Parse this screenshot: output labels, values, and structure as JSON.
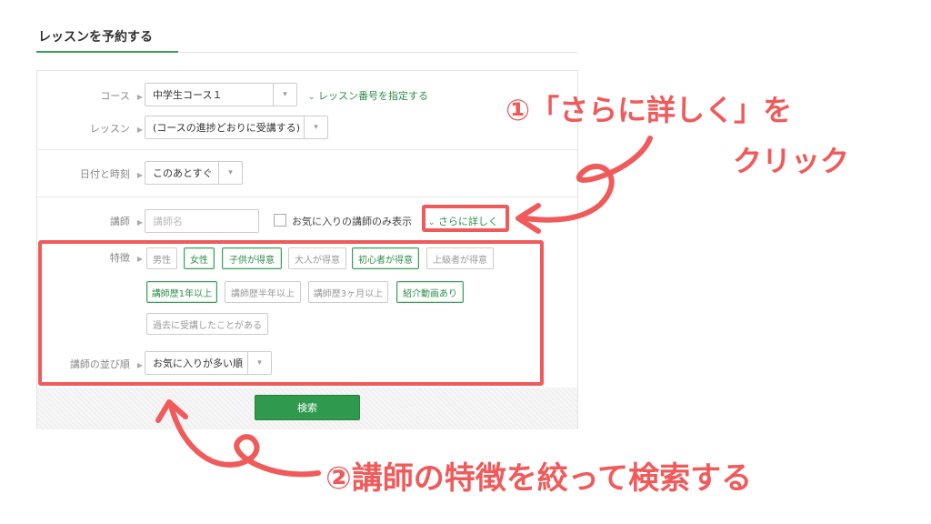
{
  "page": {
    "title": "レッスンを予約する"
  },
  "course": {
    "label": "コース",
    "value": "中学生コース１",
    "link": "レッスン番号を指定する"
  },
  "lesson": {
    "label": "レッスン",
    "value": "(コースの進捗どおりに受講する)"
  },
  "datetime": {
    "label": "日付と時刻",
    "value": "このあとすぐ"
  },
  "teacher": {
    "label": "講師",
    "name_placeholder": "講師名",
    "favorites_only": "お気に入りの講師のみ表示",
    "more_link": "さらに詳しく"
  },
  "features": {
    "label": "特徴",
    "chips": [
      {
        "text": "男性",
        "active": false
      },
      {
        "text": "女性",
        "active": true
      },
      {
        "text": "子供が得意",
        "active": true
      },
      {
        "text": "大人が得意",
        "active": false
      },
      {
        "text": "初心者が得意",
        "active": true
      },
      {
        "text": "上級者が得意",
        "active": false
      },
      {
        "text": "講師歴1年以上",
        "active": true
      },
      {
        "text": "講師歴半年以上",
        "active": false
      },
      {
        "text": "講師歴3ヶ月以上",
        "active": false
      },
      {
        "text": "紹介動画あり",
        "active": true
      },
      {
        "text": "過去に受講したことがある",
        "active": false
      }
    ]
  },
  "sort": {
    "label": "講師の並び順",
    "value": "お気に入りが多い順"
  },
  "search_button": "検索",
  "annotations": {
    "step1_line1": "①「さらに詳しく」を",
    "step1_line2": "クリック",
    "step2": "②講師の特徴を絞って検索する"
  },
  "colors": {
    "accent_green": "#2f9a4e",
    "annotation_red": "#f05a5a"
  },
  "icons": {
    "row_marker": "triangle-right-icon",
    "select_arrow": "chevron-down-icon",
    "link_marker": "chevron-down-icon"
  }
}
